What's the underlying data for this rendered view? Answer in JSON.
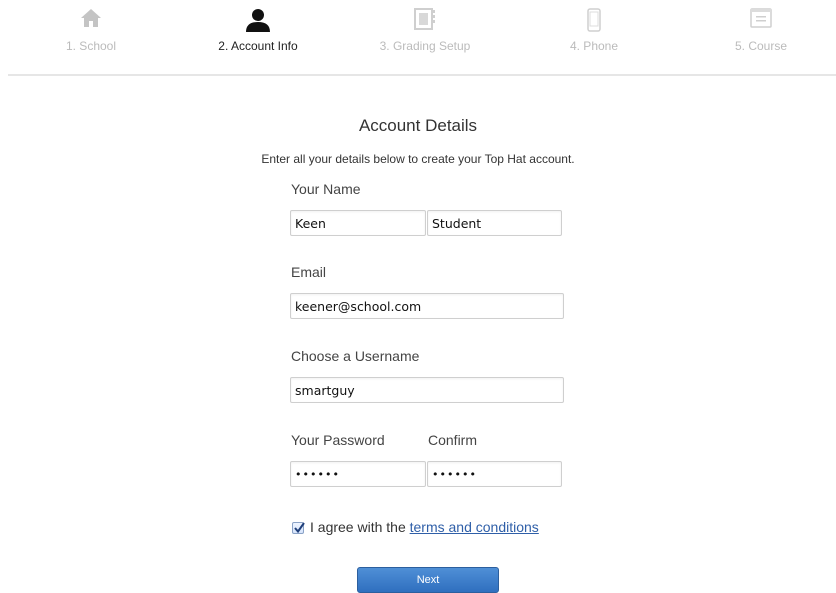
{
  "steps": [
    {
      "label": "1. School",
      "icon": "home-icon",
      "active": false
    },
    {
      "label": "2. Account Info",
      "icon": "person-icon",
      "active": true
    },
    {
      "label": "3. Grading Setup",
      "icon": "gradebook-icon",
      "active": false
    },
    {
      "label": "4. Phone",
      "icon": "phone-icon",
      "active": false
    },
    {
      "label": "5. Course",
      "icon": "course-icon",
      "active": false
    }
  ],
  "form": {
    "title": "Account Details",
    "subtitle": "Enter all your details below to create your Top Hat account.",
    "name_label": "Your Name",
    "first_name": "Keen",
    "last_name": "Student",
    "email_label": "Email",
    "email": "keener@school.com",
    "username_label": "Choose a Username",
    "username": "smartguy",
    "password_label": "Your Password",
    "confirm_label": "Confirm",
    "password": "••••••",
    "confirm": "••••••",
    "agree_prefix": "I agree with the ",
    "terms_link": "terms and conditions",
    "agree_checked": true,
    "next_label": "Next"
  },
  "colors": {
    "active_text": "#222222",
    "inactive": "#bbbbbb",
    "link": "#2f5fa8",
    "button": "#3a7bc8"
  }
}
